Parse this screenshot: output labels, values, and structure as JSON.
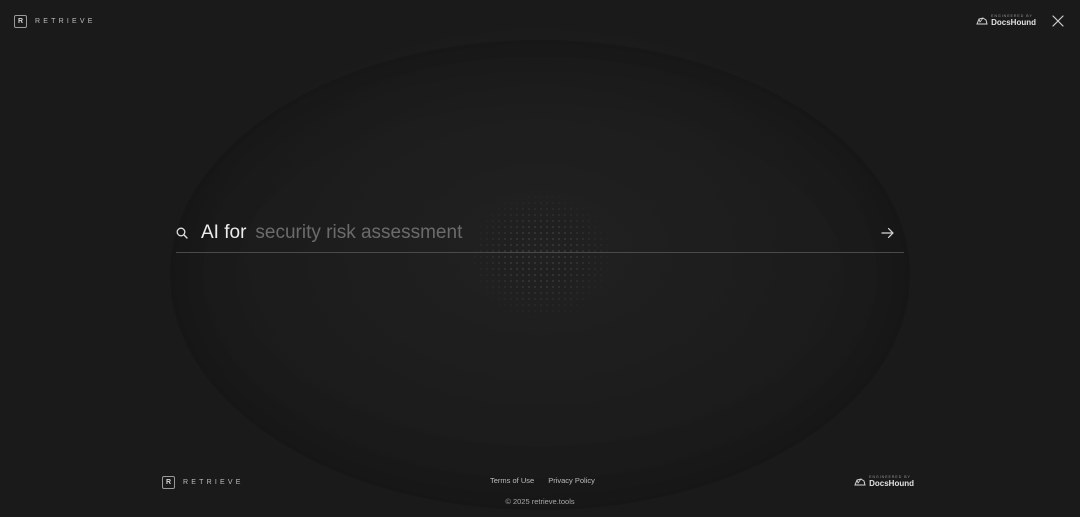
{
  "header": {
    "brand_name": "RETRIEVE",
    "logo_glyph": "R",
    "docshound_badge": {
      "eyebrow": "ENGINEERED BY",
      "name": "DocsHound"
    },
    "close_icon": "close-icon"
  },
  "search": {
    "prefix": "AI for",
    "placeholder": "security risk assessment",
    "value": "",
    "search_icon": "search-icon",
    "submit_icon": "arrow-right-icon"
  },
  "footer": {
    "brand_name": "RETRIEVE",
    "logo_glyph": "R",
    "links": [
      {
        "label": "Terms of Use"
      },
      {
        "label": "Privacy Policy"
      }
    ],
    "docshound_badge": {
      "eyebrow": "ENGINEERED BY",
      "name": "DocsHound"
    },
    "copyright": "© 2025 retrieve.tools"
  },
  "colors": {
    "background": "#1c1c1c",
    "text": "#e8e8e8",
    "placeholder": "#6b6b6b",
    "divider": "#4a4a4a"
  }
}
